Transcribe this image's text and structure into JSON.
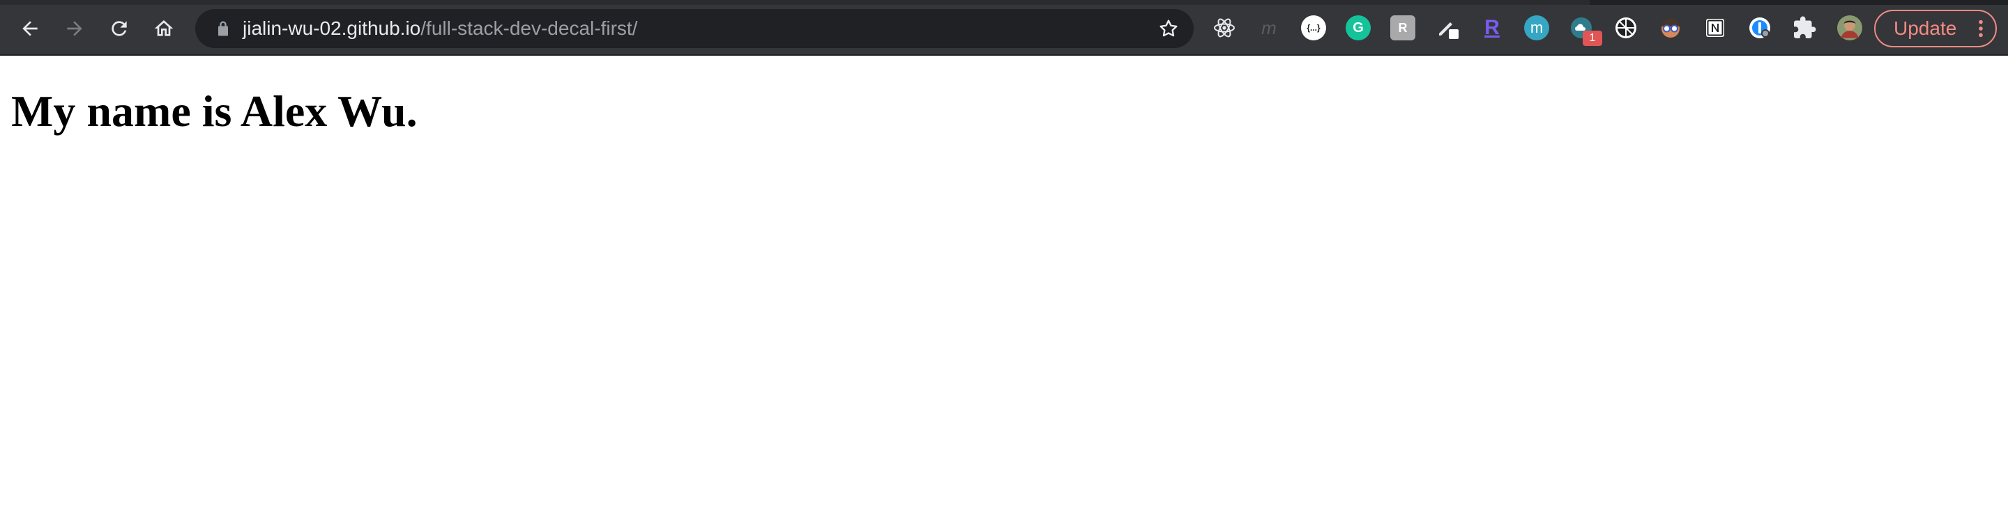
{
  "browser": {
    "url_host": "jialin-wu-02.github.io",
    "url_path": "/full-stack-dev-decal-first/",
    "update_label": "Update",
    "extensions": [
      {
        "name": "react-devtools-icon",
        "glyph": ""
      },
      {
        "name": "m-italic-ext-icon",
        "glyph": "m"
      },
      {
        "name": "json-viewer-icon",
        "glyph": "{...}"
      },
      {
        "name": "grammarly-icon",
        "glyph": "G"
      },
      {
        "name": "rakuten-ext-icon",
        "glyph": "R"
      },
      {
        "name": "pen-ext-icon",
        "glyph": ""
      },
      {
        "name": "r-ext-icon",
        "glyph": "R"
      },
      {
        "name": "m-circle-ext-icon",
        "glyph": "m"
      },
      {
        "name": "cloud-ext-icon",
        "glyph": ""
      },
      {
        "name": "camera-ext-icon",
        "glyph": ""
      },
      {
        "name": "character-ext-icon",
        "glyph": ""
      },
      {
        "name": "notion-icon",
        "glyph": "N"
      },
      {
        "name": "onepassword-icon",
        "glyph": ""
      },
      {
        "name": "extensions-puzzle-icon",
        "glyph": ""
      }
    ],
    "badge_count": "1"
  },
  "page": {
    "heading": "My name is Alex Wu."
  },
  "colors": {
    "toolbar_bg": "#35363a",
    "omnibox_bg": "#202124",
    "update_accent": "#f28b82"
  }
}
